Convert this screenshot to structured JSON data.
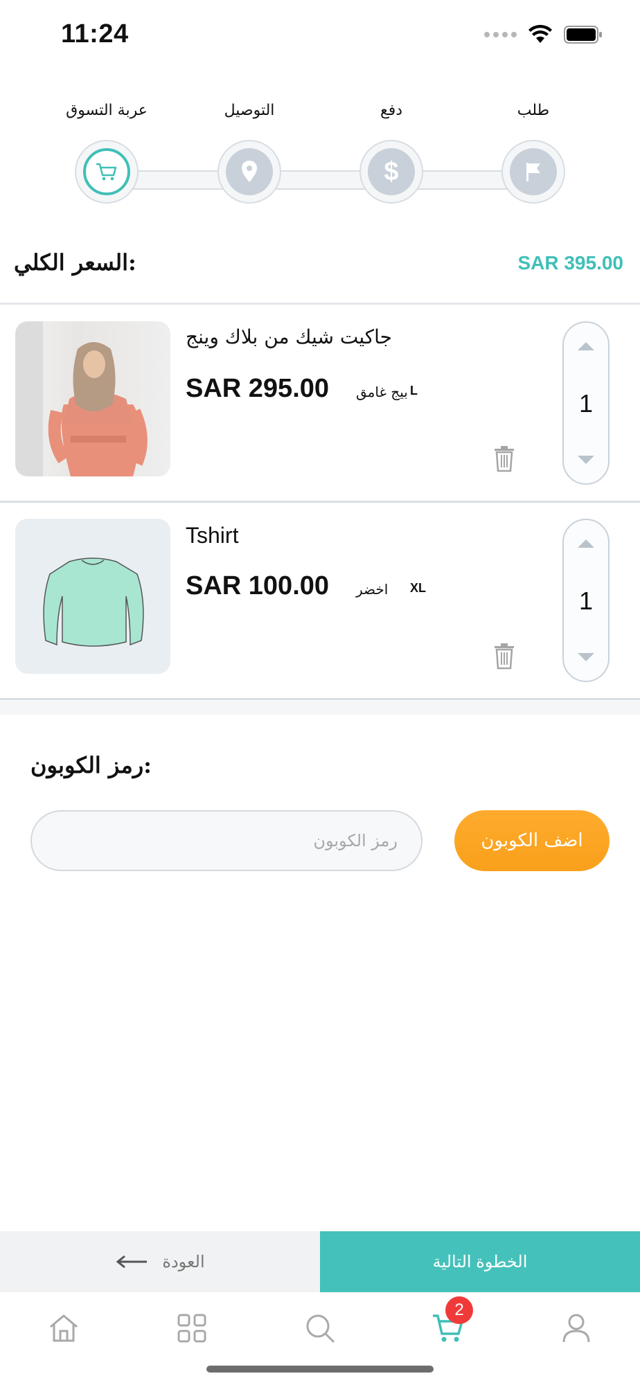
{
  "status_bar": {
    "time": "11:24"
  },
  "stepper": {
    "steps": [
      {
        "label": "عربة التسوق",
        "icon": "cart-icon",
        "active": true
      },
      {
        "label": "التوصيل",
        "icon": "location-pin-icon",
        "active": false
      },
      {
        "label": "دفع",
        "icon": "dollar-icon",
        "active": false
      },
      {
        "label": "طلب",
        "icon": "flag-icon",
        "active": false
      }
    ]
  },
  "total": {
    "label": "السعر الكلي:",
    "value": "SAR 395.00"
  },
  "cart": {
    "items": [
      {
        "name": "جاكيت شيك من بلاك وينج",
        "price": "SAR 295.00",
        "color": "بيج غامق",
        "size": "L",
        "quantity": "1",
        "image": "woman-in-pink-dress-photo"
      },
      {
        "name": "Tshirt",
        "price": "SAR 100.00",
        "color": "اخضر",
        "size": "XL",
        "quantity": "1",
        "image": "mint-long-sleeve-shirt-sketch"
      }
    ]
  },
  "coupon": {
    "label": "رمز الكوبون:",
    "placeholder": "رمز الكوبون",
    "button_label": "اضف الكوبون"
  },
  "actions": {
    "back_label": "العودة",
    "next_label": "الخطوة التالية"
  },
  "tab_bar": {
    "tabs": [
      "home-icon",
      "grid-icon",
      "search-icon",
      "cart-icon",
      "user-icon"
    ],
    "cart_badge": "2"
  },
  "colors": {
    "accent": "#3fbfb7",
    "orange": "#f9a01b",
    "badge": "#f03a3a"
  }
}
